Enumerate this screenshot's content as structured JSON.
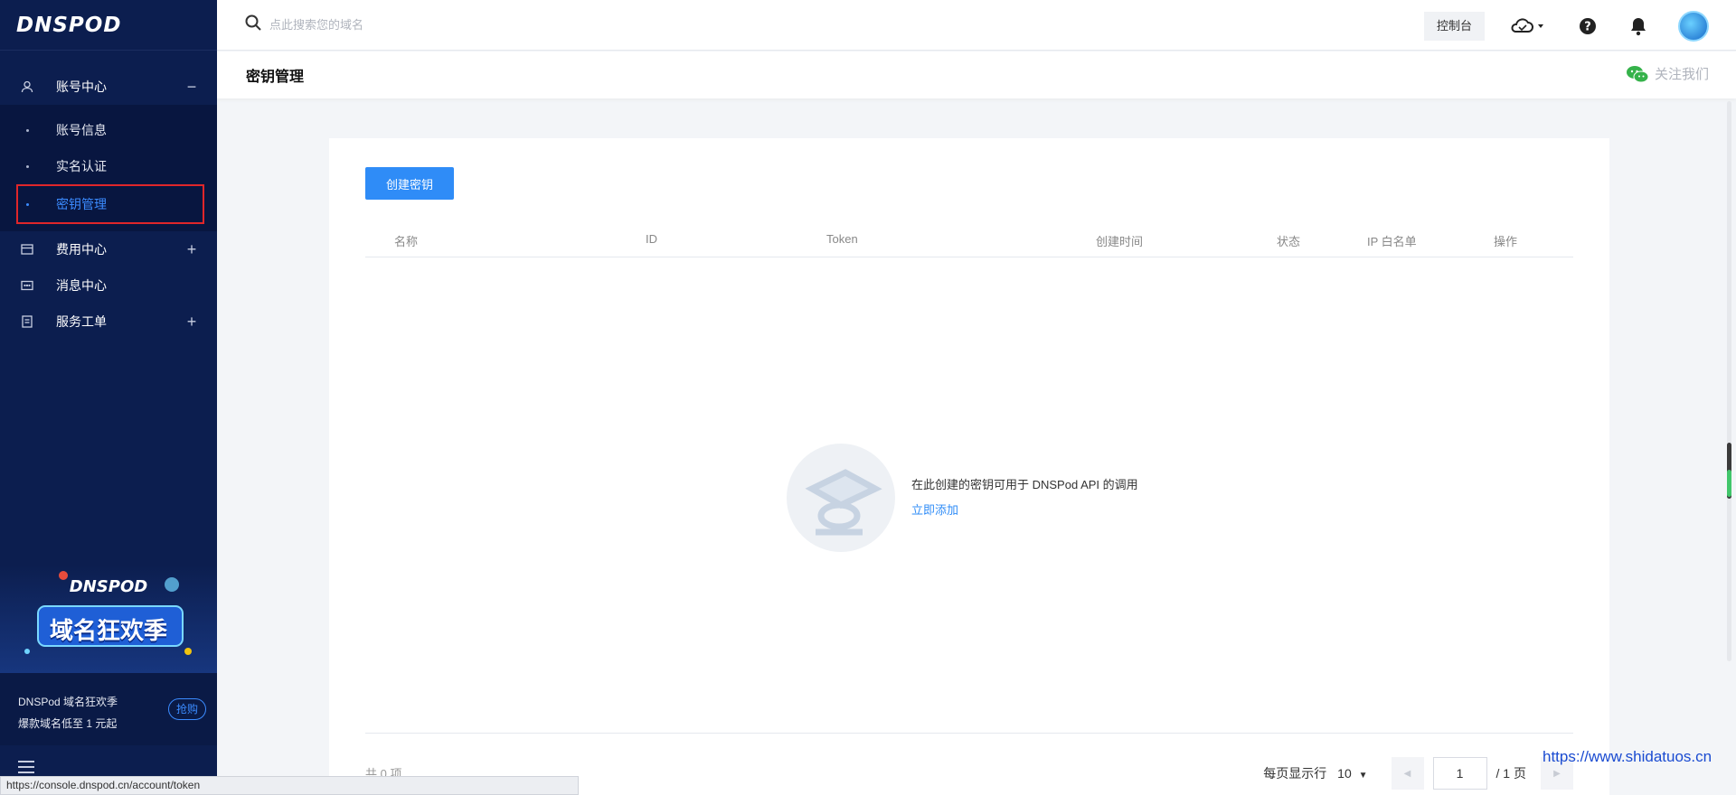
{
  "sidebar": {
    "logo": "DNSPOD",
    "groups": [
      {
        "label": "账号中心",
        "toggle": "−"
      },
      {
        "label": "费用中心",
        "toggle": "+"
      },
      {
        "label": "消息中心",
        "toggle": ""
      },
      {
        "label": "服务工单",
        "toggle": "+"
      }
    ],
    "sub_items": [
      {
        "label": "账号信息"
      },
      {
        "label": "实名认证"
      },
      {
        "label": "密钥管理"
      }
    ],
    "promo": {
      "banner_line1": "DNSPOD",
      "banner_line2": "域名狂欢季",
      "title": "DNSPod 域名狂欢季",
      "subtitle": "爆款域名低至 1 元起",
      "button": "抢购"
    }
  },
  "topbar": {
    "search_placeholder": "点此搜索您的域名",
    "console_label": "控制台"
  },
  "titlebar": {
    "title": "密钥管理",
    "follow_label": "关注我们"
  },
  "content": {
    "create_button": "创建密钥",
    "columns": [
      "名称",
      "ID",
      "Token",
      "创建时间",
      "状态",
      "IP 白名单",
      "操作"
    ],
    "empty_text": "在此创建的密钥可用于 DNSPod API 的调用",
    "empty_link": "立即添加",
    "total": "共 0 项",
    "page_size_label": "每页显示行",
    "page_size_value": "10",
    "current_page": "1",
    "total_pages": "/ 1 页"
  },
  "status_url": "https://console.dnspod.cn/account/token",
  "watermark": "https://www.shidatuos.cn",
  "colors": {
    "sidebar_bg": "#0c1e4f",
    "accent": "#2f8cf7",
    "active_highlight_border": "#e0262a"
  }
}
